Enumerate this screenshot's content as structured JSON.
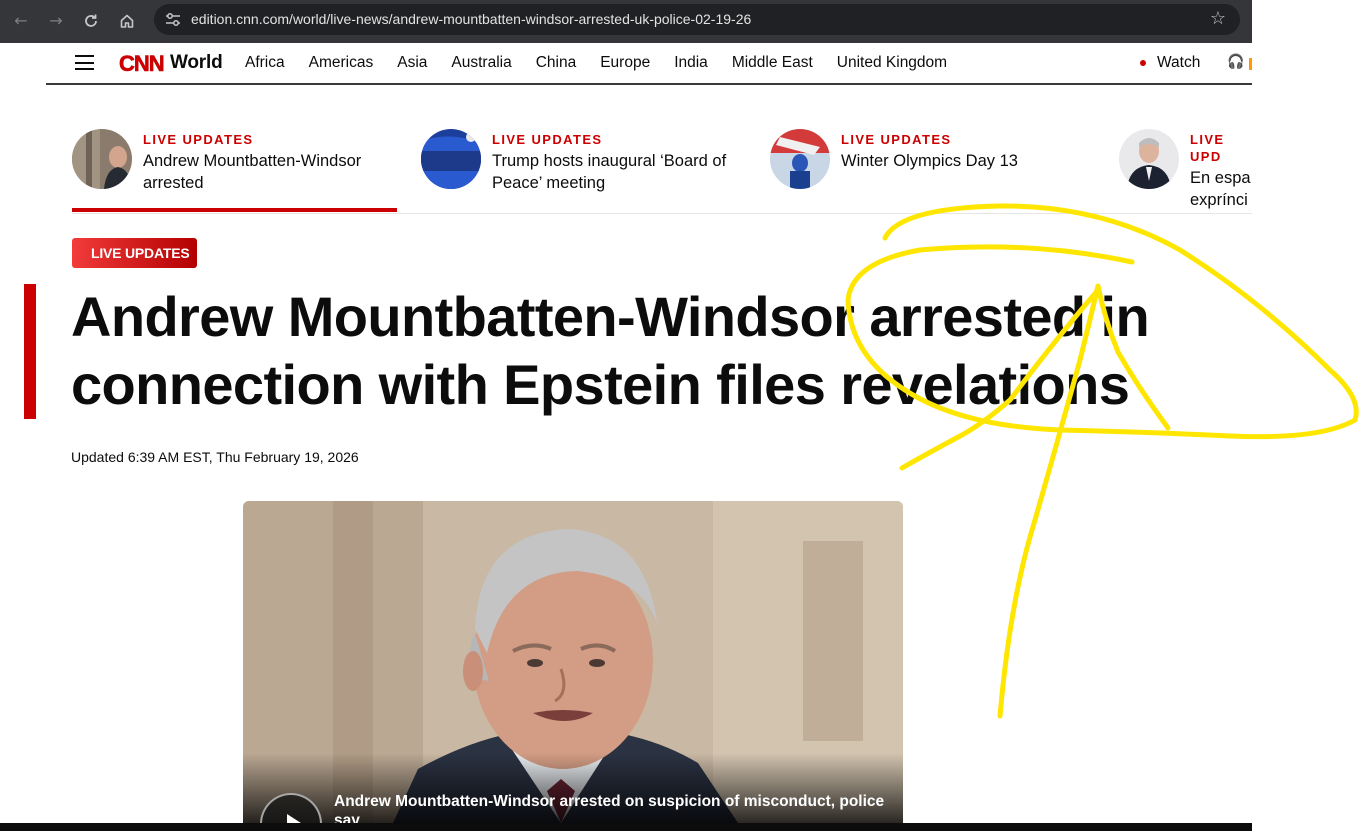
{
  "browser": {
    "url": "edition.cnn.com/world/live-news/andrew-mountbatten-windsor-arrested-uk-police-02-19-26"
  },
  "header": {
    "logo": "CNN",
    "edition": "World",
    "nav": [
      "Africa",
      "Americas",
      "Asia",
      "Australia",
      "China",
      "Europe",
      "India",
      "Middle East",
      "United Kingdom"
    ],
    "watch": "Watch"
  },
  "live_strip": [
    {
      "kicker": "LIVE UPDATES",
      "title": "Andrew Mountbatten-Windsor arrested"
    },
    {
      "kicker": "LIVE UPDATES",
      "title": "Trump hosts inaugural ‘Board of Peace’ meeting"
    },
    {
      "kicker": "LIVE UPDATES",
      "title": "Winter Olympics Day 13"
    },
    {
      "kicker": "LIVE UPD",
      "title": "En espa exprínci"
    }
  ],
  "article": {
    "badge": "LIVE UPDATES",
    "headline": "Andrew Mountbatten-Windsor arrested in connection with Epstein files revelations",
    "timestamp": "Updated 6:39 AM EST, Thu February 19, 2026",
    "video_caption": "Andrew Mountbatten-Windsor arrested on suspicion of misconduct, police say"
  },
  "colors": {
    "brand_red": "#cc0000",
    "annotation": "#ffe600",
    "chrome_bg": "#35363a"
  },
  "icons": [
    "back-arrow-icon",
    "forward-arrow-icon",
    "reload-icon",
    "home-icon",
    "site-info-icon",
    "bookmark-star-icon",
    "hamburger-menu-icon",
    "headphones-icon",
    "play-icon"
  ]
}
